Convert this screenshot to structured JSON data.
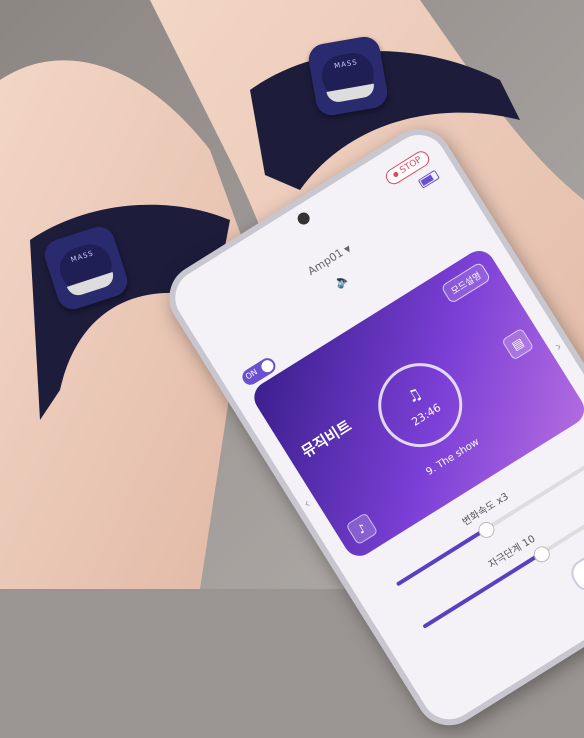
{
  "app": {
    "stop_label": "STOP",
    "device_name": "Amp01",
    "toggle_label": "ON",
    "mode_desc_button": "모드설명",
    "mode_title": "뮤직비트",
    "timer": "23:46",
    "track": "9. The show",
    "change_speed_label": "변화속도  x3",
    "intensity_label": "자극단계  10",
    "pause_symbol": "II"
  },
  "pads": [
    {
      "logo": "MASS"
    },
    {
      "logo": "MASS"
    }
  ],
  "colors": {
    "accent": "#6a4fd0",
    "card_start": "#3a1f8c",
    "card_end": "#b36ce0",
    "stop": "#e0475c"
  }
}
